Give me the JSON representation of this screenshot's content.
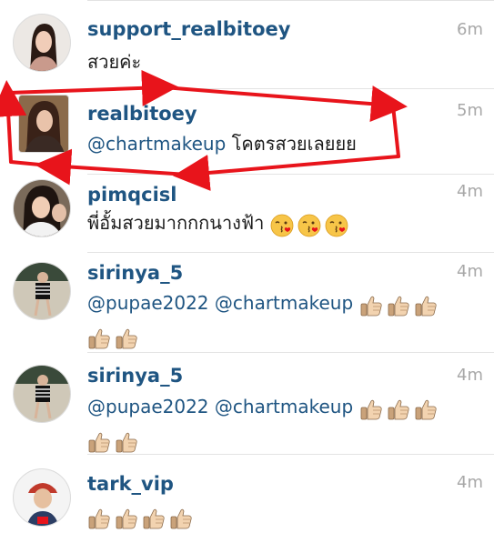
{
  "comments": [
    {
      "username": "support_realbitoey",
      "time": "6m",
      "text": "สวยค่ะ"
    },
    {
      "username": "realbitoey",
      "time": "5m",
      "mention": "@chartmakeup",
      "text": "โคตรสวยเลยยย"
    },
    {
      "username": "pimqcisl",
      "time": "4m",
      "text": "พี่อั้มสวยมากกกนางฟ้า",
      "emoji": "kissing-face-icon",
      "emoji_count": 3
    },
    {
      "username": "sirinya_5",
      "time": "4m",
      "mention1": "@pupae2022",
      "mention2": "@chartmakeup",
      "emoji": "thumbs-up-icon",
      "emoji_count": 5
    },
    {
      "username": "sirinya_5",
      "time": "4m",
      "mention1": "@pupae2022",
      "mention2": "@chartmakeup",
      "emoji": "thumbs-up-icon",
      "emoji_count": 5
    },
    {
      "username": "tark_vip",
      "time": "4m",
      "emoji": "thumbs-up-icon",
      "emoji_count": 4
    }
  ],
  "annotation_color": "#e8141b",
  "link_color": "#1f5582"
}
